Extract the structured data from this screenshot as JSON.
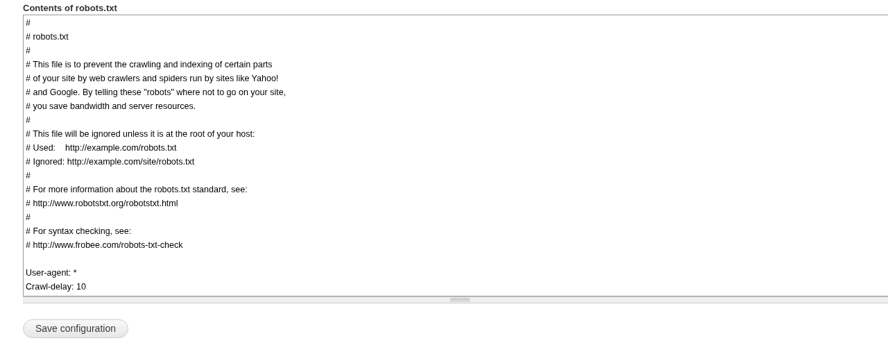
{
  "field": {
    "label": "Contents of robots.txt",
    "blocks": [
      {
        "lines": [
          "#",
          "# robots.txt",
          "#",
          "# This file is to prevent the crawling and indexing of certain parts",
          "# of your site by web crawlers and spiders run by sites like Yahoo!",
          "# and Google. By telling these \"robots\" where not to go on your site,",
          "# you save bandwidth and server resources.",
          "#",
          "# This file will be ignored unless it is at the root of your host:",
          "# Used:    http://example.com/robots.txt",
          "# Ignored: http://example.com/site/robots.txt",
          "#",
          "# For more information about the robots.txt standard, see:",
          "# http://www.robotstxt.org/robotstxt.html",
          "#",
          "# For syntax checking, see:",
          "# http://www.frobee.com/robots-txt-check"
        ]
      },
      {
        "lines": [
          "User-agent: *",
          "Crawl-delay: 10"
        ]
      }
    ]
  },
  "buttons": [
    "Save configuration"
  ]
}
